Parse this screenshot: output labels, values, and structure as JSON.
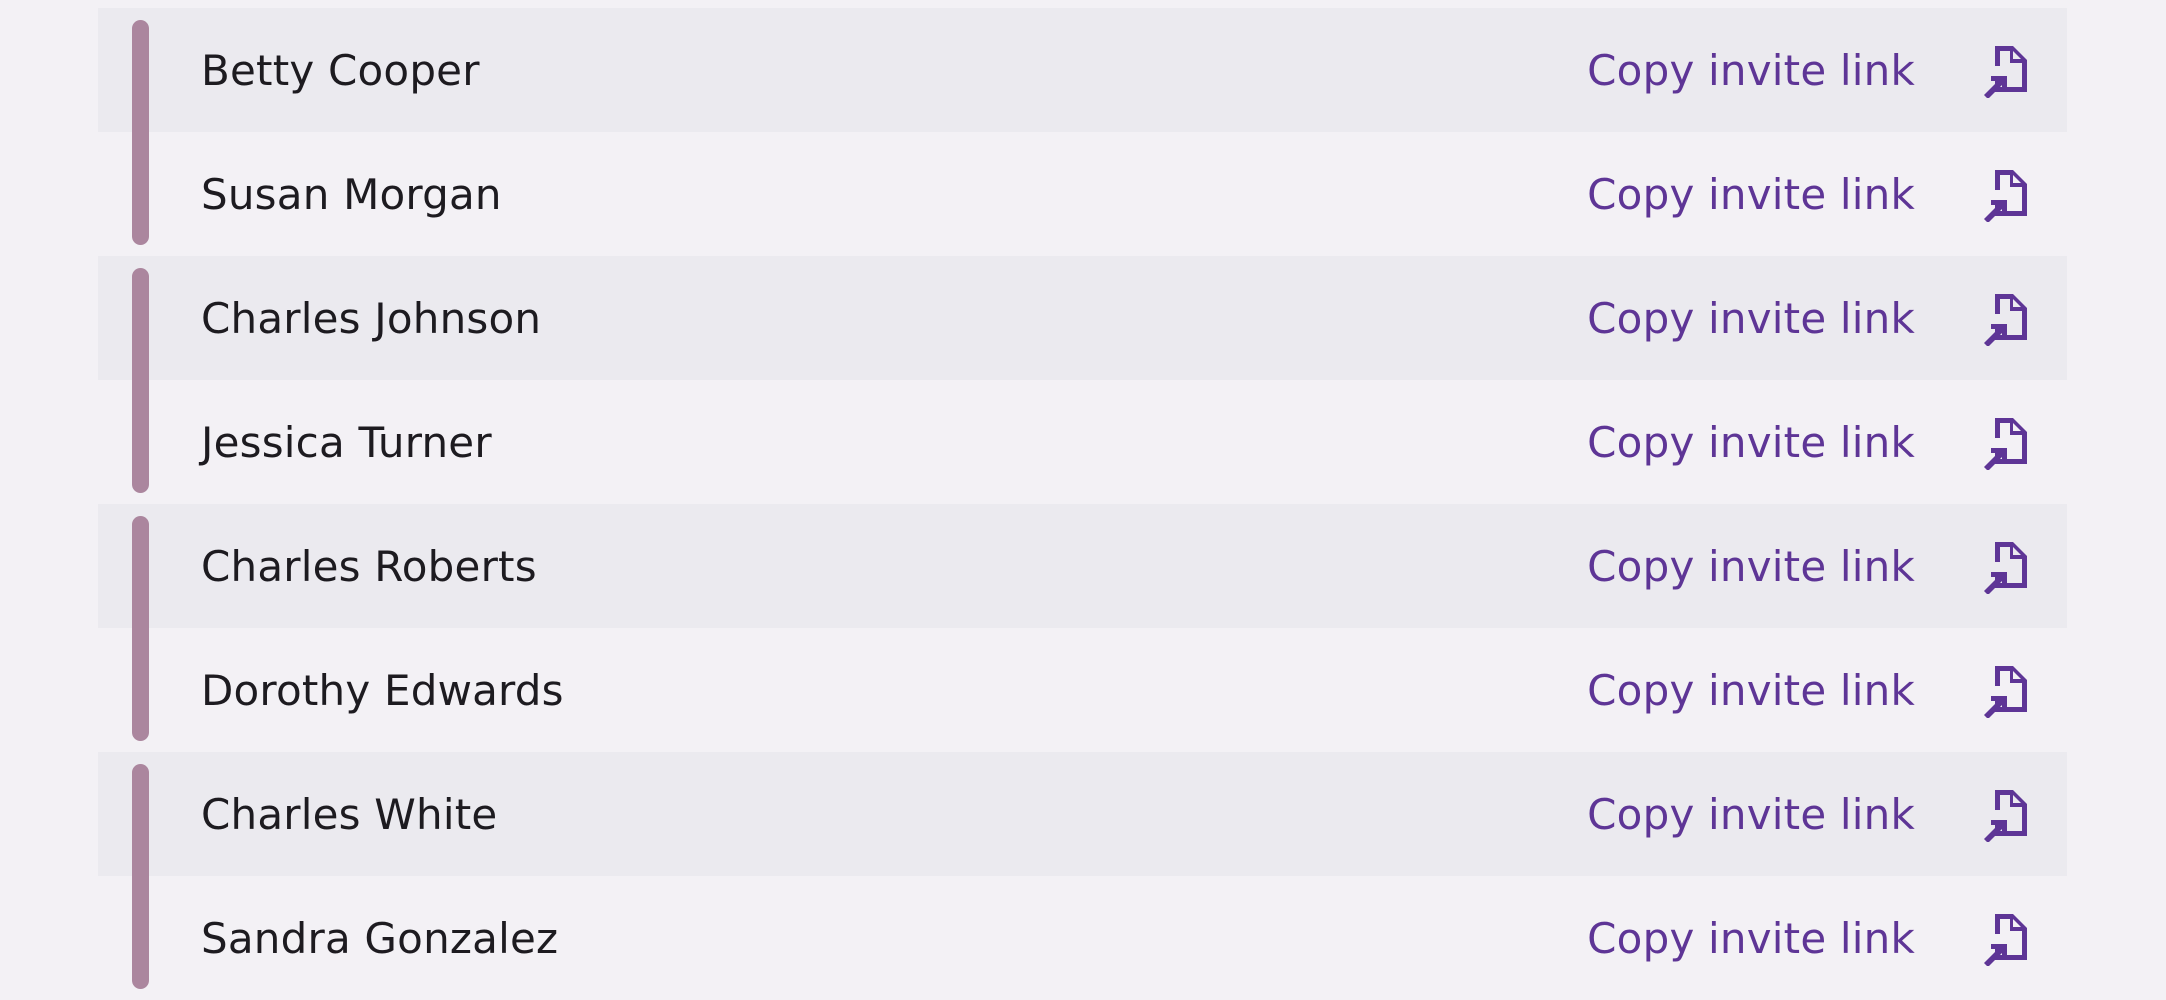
{
  "colors": {
    "background": "#f3f1f5",
    "row_shaded": "#ebeaef",
    "group_bar": "#ab869e",
    "text": "#1d1b20",
    "accent": "#5e3596"
  },
  "invites": [
    {
      "name": "Betty Cooper",
      "action": "Copy invite link",
      "icon": "file-link-icon"
    },
    {
      "name": "Susan Morgan",
      "action": "Copy invite link",
      "icon": "file-link-icon"
    },
    {
      "name": "Charles Johnson",
      "action": "Copy invite link",
      "icon": "file-link-icon"
    },
    {
      "name": "Jessica Turner",
      "action": "Copy invite link",
      "icon": "file-link-icon"
    },
    {
      "name": "Charles Roberts",
      "action": "Copy invite link",
      "icon": "file-link-icon"
    },
    {
      "name": "Dorothy Edwards",
      "action": "Copy invite link",
      "icon": "file-link-icon"
    },
    {
      "name": "Charles White",
      "action": "Copy invite link",
      "icon": "file-link-icon"
    },
    {
      "name": "Sandra Gonzalez",
      "action": "Copy invite link",
      "icon": "file-link-icon"
    }
  ]
}
